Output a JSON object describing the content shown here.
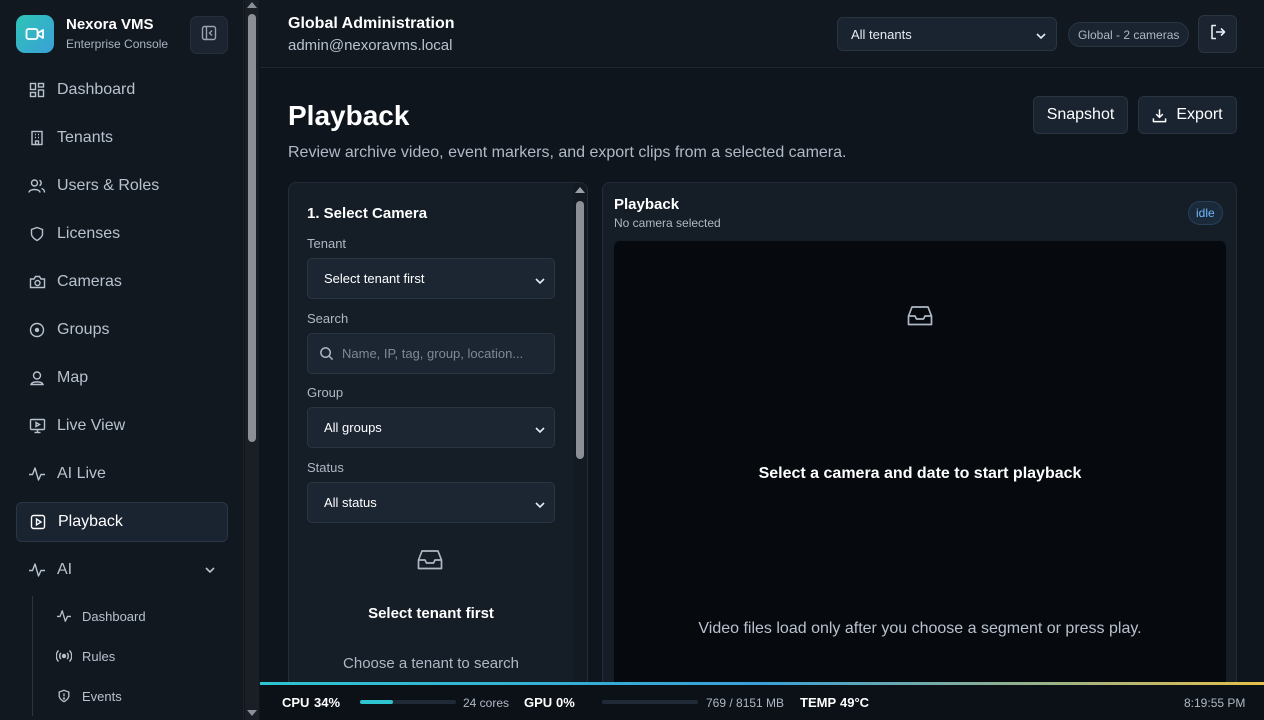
{
  "brand": {
    "name": "Nexora VMS",
    "subtitle": "Enterprise Console"
  },
  "nav": [
    {
      "label": "Dashboard",
      "icon": "dashboard-icon"
    },
    {
      "label": "Tenants",
      "icon": "building-icon"
    },
    {
      "label": "Users & Roles",
      "icon": "users-icon"
    },
    {
      "label": "Licenses",
      "icon": "shield-icon"
    },
    {
      "label": "Cameras",
      "icon": "camera-icon"
    },
    {
      "label": "Groups",
      "icon": "target-icon"
    },
    {
      "label": "Map",
      "icon": "map-pin-icon"
    },
    {
      "label": "Live View",
      "icon": "monitor-icon"
    },
    {
      "label": "AI Live",
      "icon": "activity-icon"
    },
    {
      "label": "Playback",
      "icon": "play-square-icon",
      "active": true
    },
    {
      "label": "AI",
      "icon": "activity-icon",
      "expanded": true
    }
  ],
  "subnav": [
    {
      "label": "Dashboard",
      "icon": "activity-icon"
    },
    {
      "label": "Rules",
      "icon": "broadcast-icon"
    },
    {
      "label": "Events",
      "icon": "shield-alert-icon"
    }
  ],
  "header": {
    "title": "Global Administration",
    "user": "admin@nexoravms.local",
    "tenant_select": "All tenants",
    "scope_badge": "Global - 2 cameras"
  },
  "page": {
    "title": "Playback",
    "description": "Review archive video, event markers, and export clips from a selected camera.",
    "snapshot_label": "Snapshot",
    "export_label": "Export"
  },
  "camera_panel": {
    "title": "1. Select Camera",
    "tenant_label": "Tenant",
    "tenant_value": "Select tenant first",
    "search_label": "Search",
    "search_placeholder": "Name, IP, tag, group, location...",
    "group_label": "Group",
    "group_value": "All groups",
    "status_label": "Status",
    "status_value": "All status",
    "empty_title": "Select tenant first",
    "empty_sub": "Choose a tenant to search"
  },
  "playback_panel": {
    "title": "Playback",
    "subtitle": "No camera selected",
    "status": "idle",
    "message": "Select a camera and date to start playback",
    "note": "Video files load only after you choose a segment or press play."
  },
  "statusbar": {
    "cpu_label": "CPU",
    "cpu_value": "34%",
    "cpu_load": 0.34,
    "cores": "24 cores",
    "gpu_label": "GPU",
    "gpu_value": "0%",
    "gpu_load": 0,
    "memory": "769 / 8151 MB",
    "temp_label": "TEMP",
    "temp_value": "49°C",
    "time": "8:19:55 PM"
  },
  "colors": {
    "accent": "#2ec4d0",
    "background": "#0f151d",
    "panel": "#151d27",
    "status_blue": "#6fb6ff"
  }
}
